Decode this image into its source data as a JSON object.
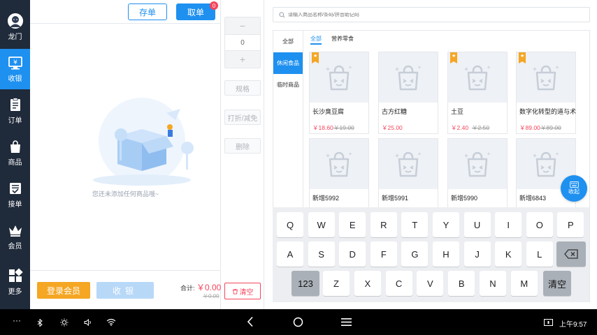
{
  "sidebar": {
    "items": [
      {
        "label": "龙门",
        "icon": "avatar-icon"
      },
      {
        "label": "收银",
        "icon": "cashier-icon",
        "active": true
      },
      {
        "label": "订单",
        "icon": "clipboard-icon"
      },
      {
        "label": "商品",
        "icon": "bag-icon"
      },
      {
        "label": "接单",
        "icon": "accept-order-icon"
      },
      {
        "label": "会员",
        "icon": "crown-icon"
      },
      {
        "label": "更多",
        "icon": "grid-icon"
      }
    ]
  },
  "order": {
    "save_label": "存单",
    "take_label": "取单",
    "take_badge": "0",
    "empty_text": "您还未添加任何商品哦~",
    "member_label": "登录会员",
    "checkout_label": "收银",
    "total_label": "合计:",
    "total_value": "￥0.00",
    "total_orig": "￥0.00"
  },
  "actions": {
    "minus": "−",
    "qty": "0",
    "plus": "+",
    "spec_label": "规格",
    "discount_label": "打折/减免",
    "delete_label": "删除",
    "clear_label": "清空"
  },
  "search": {
    "placeholder": "请输入商品名称/条码/拼音助记码"
  },
  "categories": [
    {
      "label": "全部"
    },
    {
      "label": "休闲食品",
      "active": true
    },
    {
      "label": "临时商品"
    }
  ],
  "subtabs": [
    {
      "label": "全部",
      "active": true
    },
    {
      "label": "营养零食"
    }
  ],
  "products": [
    {
      "name": "长沙臭豆腐",
      "price": "￥18.60",
      "orig": "￥19.00",
      "featured": true
    },
    {
      "name": "古方红糖",
      "price": "￥25.00",
      "orig": "",
      "featured": false
    },
    {
      "name": "土豆",
      "price": "￥2.40",
      "orig": "￥2.50",
      "featured": true
    },
    {
      "name": "数字化转型的道与术",
      "price": "￥89.00",
      "orig": "￥89.00",
      "featured": true
    },
    {
      "name": "新增5992",
      "price": "",
      "orig": "",
      "featured": false
    },
    {
      "name": "新增5991",
      "price": "",
      "orig": "",
      "featured": false
    },
    {
      "name": "新增5990",
      "price": "",
      "orig": "",
      "featured": false
    },
    {
      "name": "新增6843",
      "price": "",
      "orig": "",
      "featured": false
    }
  ],
  "featured_star": "★",
  "collapse_label": "收起",
  "keyboard": {
    "row1": [
      "Q",
      "W",
      "E",
      "R",
      "T",
      "Y",
      "U",
      "I",
      "O",
      "P"
    ],
    "row2": [
      "A",
      "S",
      "D",
      "F",
      "G",
      "H",
      "J",
      "K",
      "L"
    ],
    "num_label": "123",
    "row3": [
      "Z",
      "X",
      "C",
      "V",
      "B",
      "N",
      "M"
    ],
    "clear_label": "清空",
    "backspace_icon": "backspace-icon"
  },
  "system_bar": {
    "time": "上午9:57",
    "ellipsis": "···"
  },
  "colors": {
    "accent": "#1e90f0",
    "sidebar": "#1f2a3a",
    "price": "#f5455c",
    "member": "#f5a623"
  }
}
